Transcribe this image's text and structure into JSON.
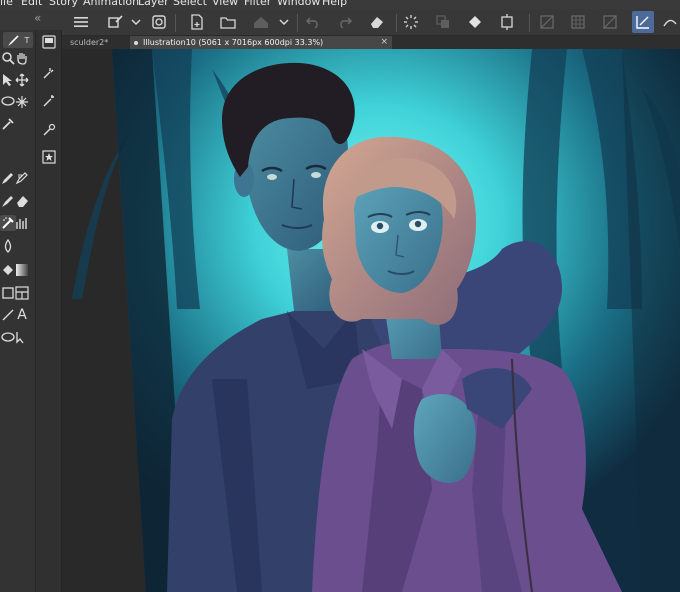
{
  "menu": {
    "items": [
      "ile",
      "Edit",
      "Story",
      "Animation",
      "Layer",
      "Select",
      "View",
      "Filter",
      "Window",
      "Help"
    ]
  },
  "document": {
    "tabs": [
      {
        "label": "sculder2*"
      },
      {
        "label": "Illustration10 (5061 x 7016px 600dpi 33.3%)"
      }
    ],
    "close_glyph": "×"
  },
  "toolbar": {
    "collapse_glyph": "«",
    "pen_label": "T",
    "text_tool_glyph": "A"
  },
  "colors": {
    "accent": "#4d6b9a",
    "canvas_bg": "#292929",
    "glow": "#4fe0e4",
    "jacket_purple": "#6a4e8e",
    "coat_navy": "#33406a"
  }
}
